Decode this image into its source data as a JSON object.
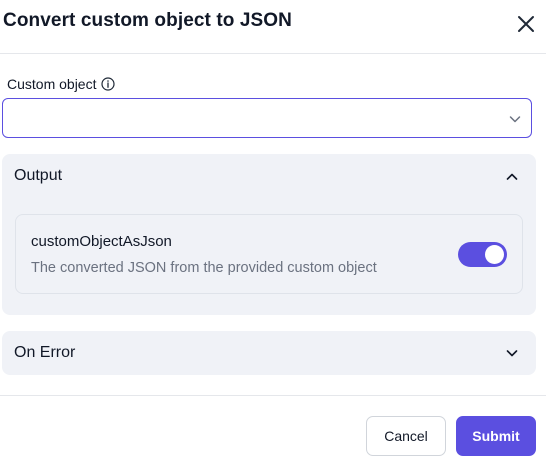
{
  "dialog": {
    "title": "Convert custom object to JSON",
    "close_icon": "close-icon"
  },
  "custom_object": {
    "label": "Custom object",
    "info_icon": "info-icon",
    "value": "",
    "chevron_icon": "chevron-down-icon"
  },
  "output": {
    "label": "Output",
    "expanded": true,
    "chevron_icon": "chevron-up-icon",
    "variable": {
      "name": "customObjectAsJson",
      "description": "The converted JSON from the provided custom object",
      "enabled": true
    }
  },
  "on_error": {
    "label": "On Error",
    "expanded": false,
    "chevron_icon": "chevron-down-icon"
  },
  "footer": {
    "cancel_label": "Cancel",
    "submit_label": "Submit"
  },
  "colors": {
    "accent": "#5b4fe0",
    "panel_bg": "#f0f2f7",
    "muted_text": "#6b7280"
  }
}
